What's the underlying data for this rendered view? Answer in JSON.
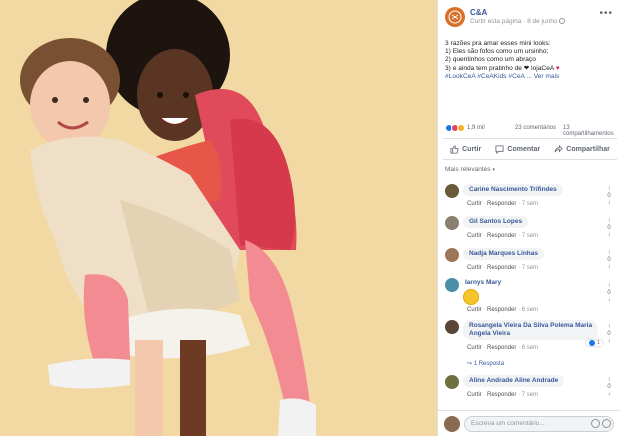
{
  "page": {
    "name": "C&A",
    "meta": "Curtir esta página · 8 de junho"
  },
  "post": {
    "lines": [
      "3 razões pra amar esses mini looks:",
      "1) Eles são fofos como um ursinho;",
      "2) quentinhos como um abraço",
      "3) e ainda tem pratinho de ❤ lojaCeA"
    ],
    "tags": "#LookCeA #CeAKids #CeA ... Ver mais",
    "heart": "♥"
  },
  "stats": {
    "reactions": "1,9 mil",
    "comments": "23 comentários",
    "shares": "13 compartilhamentos"
  },
  "actions": {
    "like": "Curtir",
    "comment": "Comentar",
    "share": "Compartilhar"
  },
  "filter": {
    "label": "Mais relevantes",
    "caret": "▾"
  },
  "comments": [
    {
      "name": "Carine Nascimento Trifindes",
      "like": "Curtir",
      "reply": "Responder",
      "time": "7 sem",
      "avatar_color": "#6b5a3a"
    },
    {
      "name": "Gil Santos Lopes",
      "like": "Curtir",
      "reply": "Responder",
      "time": "7 sem",
      "avatar_color": "#8b7f6f"
    },
    {
      "name": "Nadja Marques Linhas",
      "like": "Curtir",
      "reply": "Responder",
      "time": "7 sem",
      "avatar_color": "#a0765a"
    },
    {
      "name": "Iarnys Mary",
      "like": "Curtir",
      "reply": "Responder",
      "time": "6 sem",
      "avatar_color": "#4a8ea8"
    },
    {
      "name": "Rosangela Vieira Da Silva Polema Maria Angela Vieira",
      "name_line1": "Rosangela Vieira Da Silva Polema Maria",
      "name_line2": "Angela Vieira",
      "like": "Curtir",
      "reply": "Responder",
      "time": "6 sem",
      "reaction_count": "1",
      "replies": "1 Resposta",
      "avatar_color": "#5a4636"
    },
    {
      "name": "Aline Andrade Aline Andrade",
      "like": "Curtir",
      "reply": "Responder",
      "time": "7 sem",
      "avatar_color": "#6e7040"
    }
  ],
  "votes": {
    "up": "↑",
    "count": "0",
    "down": "↓"
  },
  "composer": {
    "placeholder": "Escreva um comentário..."
  },
  "more": "•••"
}
